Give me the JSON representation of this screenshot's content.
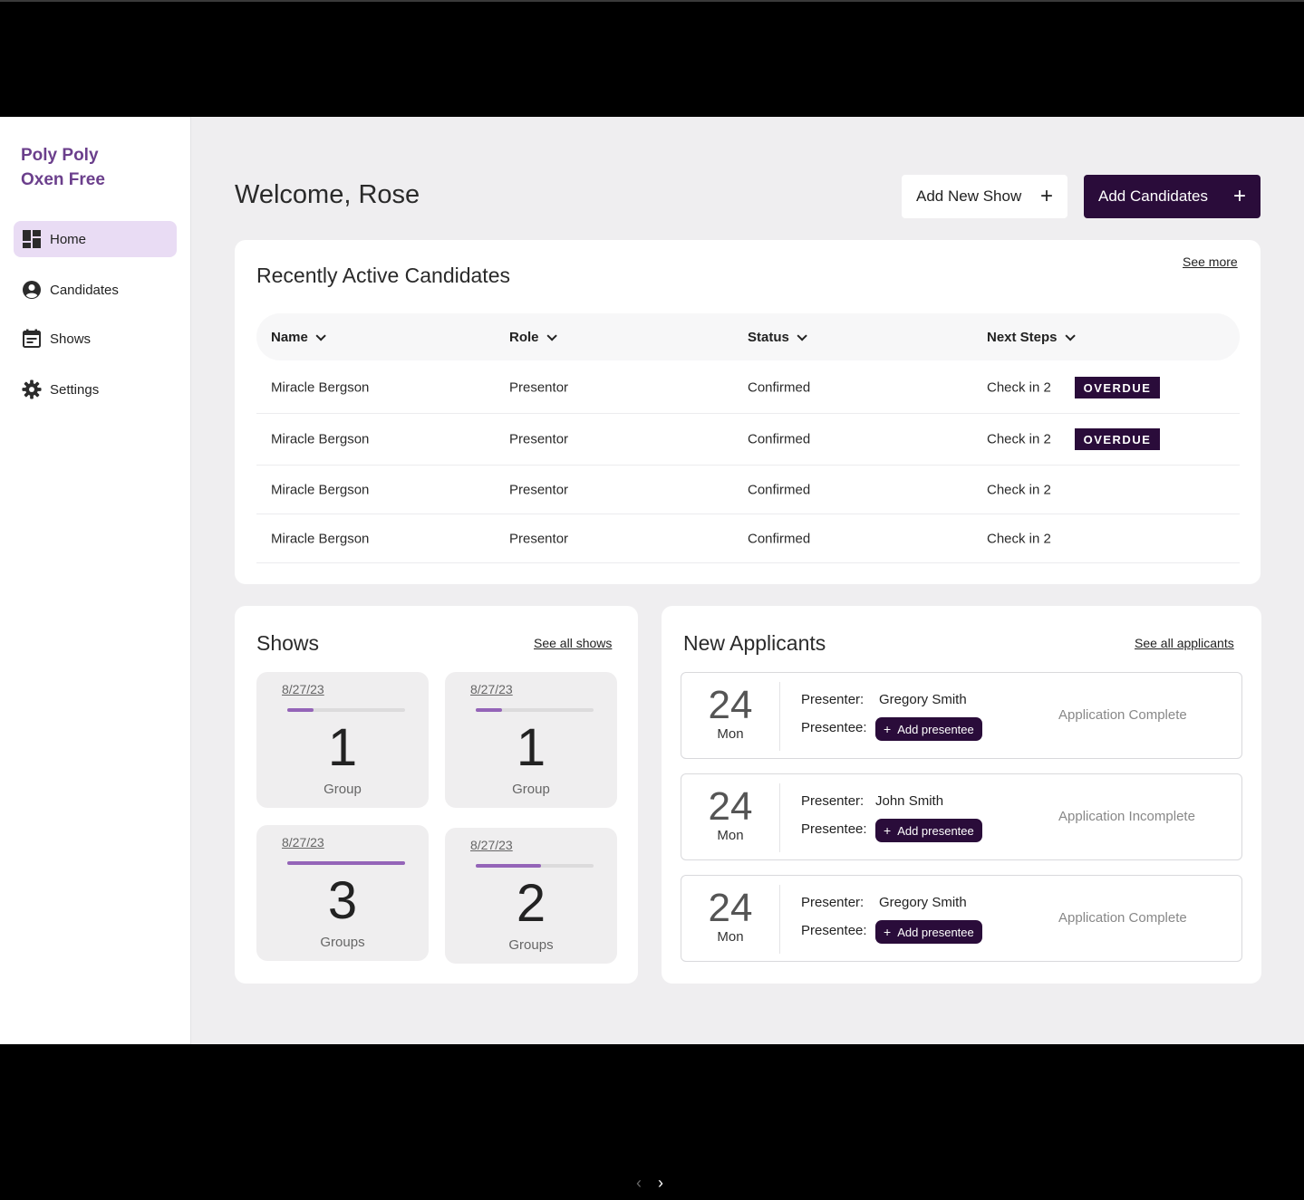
{
  "brand": {
    "name": "Poly Poly\nOxen Free",
    "accent": "#6b3f8c",
    "dark": "#2a0c3a"
  },
  "sidebar": {
    "items": [
      {
        "label": "Home",
        "icon": "dashboard-icon",
        "active": true
      },
      {
        "label": "Candidates",
        "icon": "account-circle-icon",
        "active": false
      },
      {
        "label": "Shows",
        "icon": "calendar-icon",
        "active": false
      },
      {
        "label": "Settings",
        "icon": "gear-icon",
        "active": false
      }
    ]
  },
  "header": {
    "welcome": "Welcome, Rose",
    "add_show_label": "Add New Show",
    "add_candidates_label": "Add Candidates",
    "plus": "+"
  },
  "recent": {
    "title": "Recently Active Candidates",
    "see_more": "See more",
    "columns": [
      "Name",
      "Role",
      "Status",
      "Next Steps"
    ],
    "rows": [
      {
        "name": "Miracle Bergson",
        "role": "Presentor",
        "status": "Confirmed",
        "next": "Check in 2",
        "badge": "OVERDUE"
      },
      {
        "name": "Miracle Bergson",
        "role": "Presentor",
        "status": "Confirmed",
        "next": "Check in 2",
        "badge": "OVERDUE"
      },
      {
        "name": "Miracle Bergson",
        "role": "Presentor",
        "status": "Confirmed",
        "next": "Check in 2",
        "badge": ""
      },
      {
        "name": "Miracle Bergson",
        "role": "Presentor",
        "status": "Confirmed",
        "next": "Check in 2",
        "badge": ""
      }
    ]
  },
  "shows": {
    "title": "Shows",
    "see_all": "See all shows",
    "tiles": [
      {
        "date": "8/27/23",
        "count": "1",
        "unit": "Group",
        "progress": 0.22
      },
      {
        "date": "8/27/23",
        "count": "1",
        "unit": "Group",
        "progress": 0.22
      },
      {
        "date": "8/27/23",
        "count": "3",
        "unit": "Groups",
        "progress": 1.0
      },
      {
        "date": "8/27/23",
        "count": "2",
        "unit": "Groups",
        "progress": 0.55
      }
    ]
  },
  "applicants": {
    "title": "New Applicants",
    "see_all": "See all applicants",
    "presenter_label": "Presenter:",
    "presentee_label": "Presentee:",
    "add_presentee_label": "Add presentee",
    "add_icon": "+",
    "rows": [
      {
        "day": "24",
        "dow": "Mon",
        "presenter": "Gregory Smith",
        "status": "Application Complete"
      },
      {
        "day": "24",
        "dow": "Mon",
        "presenter": "John Smith",
        "status": "Application Incomplete"
      },
      {
        "day": "24",
        "dow": "Mon",
        "presenter": "Gregory Smith",
        "status": "Application Complete"
      }
    ]
  },
  "pager": {
    "prev": "‹",
    "next": "›"
  }
}
